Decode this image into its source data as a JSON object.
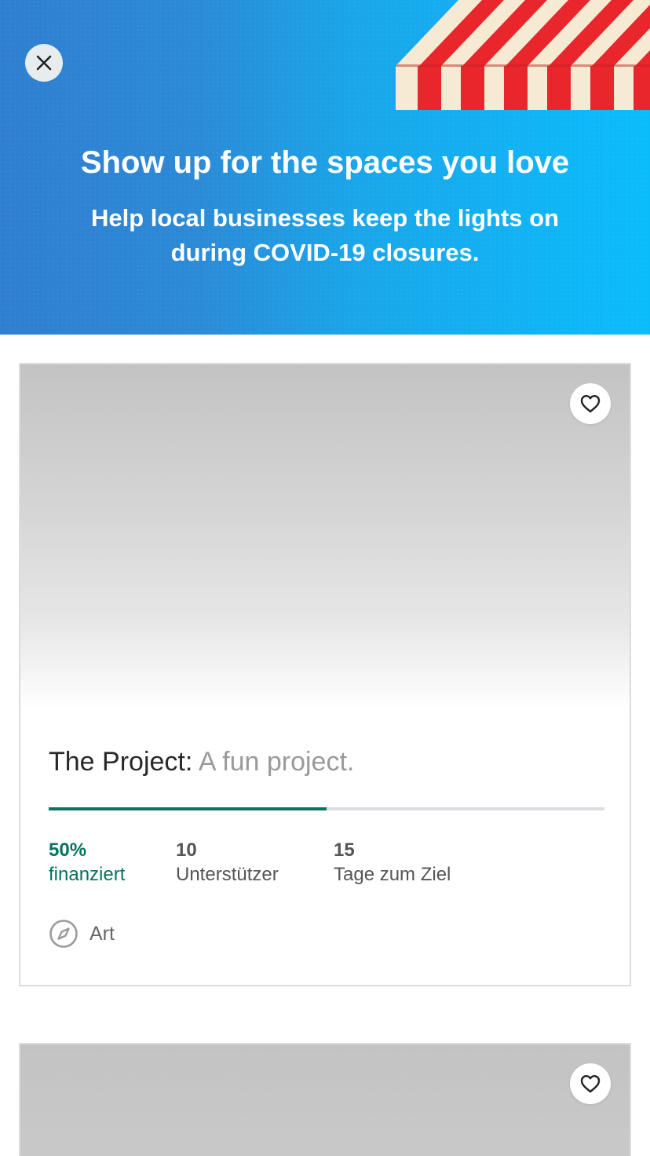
{
  "hero": {
    "title": "Show up for the spaces you love",
    "subtitle": "Help local businesses keep the lights on during COVID-19 closures.",
    "colors": {
      "gradient_start": "#2f7fd0",
      "gradient_end": "#0bbcfb",
      "awning_red": "#e8262c",
      "awning_cream": "#f6ead3"
    },
    "close_icon": "close-icon"
  },
  "projects": [
    {
      "name": "The Project:",
      "blurb": " A fun project.",
      "funded_fraction": 0.5,
      "stats": {
        "funded_value": "50%",
        "funded_label": "finanziert",
        "backers_value": "10",
        "backers_label": "Unterstützer",
        "days_value": "15",
        "days_label": "Tage zum Ziel"
      },
      "category": "Art",
      "category_icon": "compass-icon",
      "favorite_icon": "heart-icon"
    },
    {
      "favorite_icon": "heart-icon"
    }
  ],
  "colors": {
    "accent": "#037362",
    "progress_track": "#dcdde3"
  }
}
